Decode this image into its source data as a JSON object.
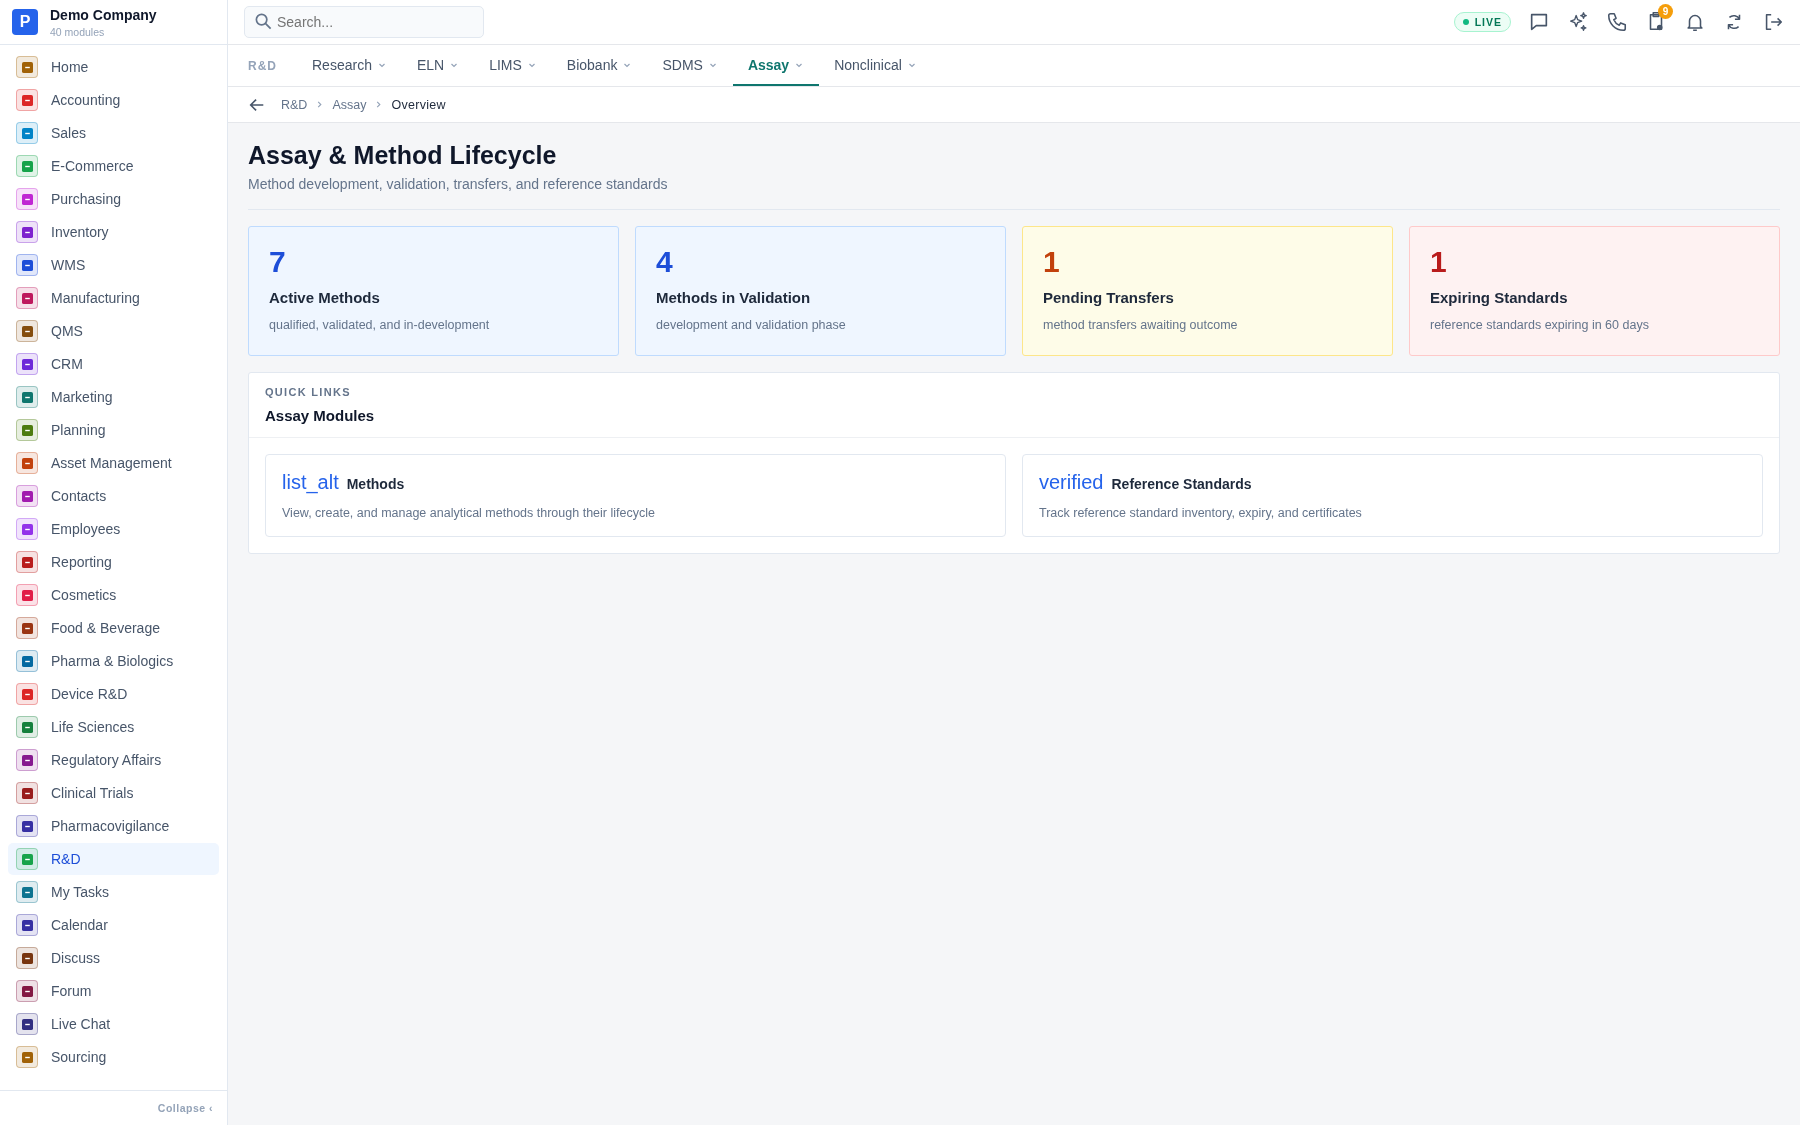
{
  "company": {
    "logo": "P",
    "name": "Demo Company",
    "subtitle": "40 modules"
  },
  "sidebar": {
    "items": [
      {
        "label": "Home",
        "color": "#a16207",
        "selected": false
      },
      {
        "label": "Accounting",
        "color": "#dc2626",
        "selected": false
      },
      {
        "label": "Sales",
        "color": "#0284c7",
        "selected": false
      },
      {
        "label": "E-Commerce",
        "color": "#16a34a",
        "selected": false
      },
      {
        "label": "Purchasing",
        "color": "#c026d3",
        "selected": false
      },
      {
        "label": "Inventory",
        "color": "#7e22ce",
        "selected": false
      },
      {
        "label": "WMS",
        "color": "#1d4ed8",
        "selected": false
      },
      {
        "label": "Manufacturing",
        "color": "#be185d",
        "selected": false
      },
      {
        "label": "QMS",
        "color": "#854d0e",
        "selected": false
      },
      {
        "label": "CRM",
        "color": "#6d28d9",
        "selected": false
      },
      {
        "label": "Marketing",
        "color": "#0f766e",
        "selected": false
      },
      {
        "label": "Planning",
        "color": "#4d7c0f",
        "selected": false
      },
      {
        "label": "Asset Management",
        "color": "#c2410c",
        "selected": false
      },
      {
        "label": "Contacts",
        "color": "#a21caf",
        "selected": false
      },
      {
        "label": "Employees",
        "color": "#9333ea",
        "selected": false
      },
      {
        "label": "Reporting",
        "color": "#b91c1c",
        "selected": false
      },
      {
        "label": "Cosmetics",
        "color": "#e11d48",
        "selected": false
      },
      {
        "label": "Food & Beverage",
        "color": "#9a3412",
        "selected": false
      },
      {
        "label": "Pharma & Biologics",
        "color": "#0369a1",
        "selected": false
      },
      {
        "label": "Device R&D",
        "color": "#dc2626",
        "selected": false
      },
      {
        "label": "Life Sciences",
        "color": "#15803d",
        "selected": false
      },
      {
        "label": "Regulatory Affairs",
        "color": "#86198f",
        "selected": false
      },
      {
        "label": "Clinical Trials",
        "color": "#991b1b",
        "selected": false
      },
      {
        "label": "Pharmacovigilance",
        "color": "#3730a3",
        "selected": false
      },
      {
        "label": "R&D",
        "color": "#16a34a",
        "selected": true
      },
      {
        "label": "My Tasks",
        "color": "#0e7490",
        "selected": false
      },
      {
        "label": "Calendar",
        "color": "#3730a3",
        "selected": false
      },
      {
        "label": "Discuss",
        "color": "#78350f",
        "selected": false
      },
      {
        "label": "Forum",
        "color": "#831843",
        "selected": false
      },
      {
        "label": "Live Chat",
        "color": "#312e81",
        "selected": false
      },
      {
        "label": "Sourcing",
        "color": "#a16207",
        "selected": false
      }
    ],
    "collapse": "Collapse",
    "collapse_icon": "‹"
  },
  "search": {
    "placeholder": "Search..."
  },
  "live_badge": "LIVE",
  "notification_count": "9",
  "nav": {
    "section": "R&D",
    "tabs": [
      {
        "label": "Research",
        "selected": false
      },
      {
        "label": "ELN",
        "selected": false
      },
      {
        "label": "LIMS",
        "selected": false
      },
      {
        "label": "Biobank",
        "selected": false
      },
      {
        "label": "SDMS",
        "selected": false
      },
      {
        "label": "Assay",
        "selected": true
      },
      {
        "label": "Nonclinical",
        "selected": false
      }
    ]
  },
  "breadcrumb": [
    "R&D",
    "Assay",
    "Overview"
  ],
  "page": {
    "title": "Assay & Method Lifecycle",
    "subtitle": "Method development, validation, transfers, and reference standards"
  },
  "stats": [
    {
      "kind": "info",
      "value": "7",
      "label": "Active Methods",
      "note": "qualified, validated, and in-development"
    },
    {
      "kind": "info",
      "value": "4",
      "label": "Methods in Validation",
      "note": "development and validation phase"
    },
    {
      "kind": "warning",
      "value": "1",
      "label": "Pending Transfers",
      "note": "method transfers awaiting outcome"
    },
    {
      "kind": "danger",
      "value": "1",
      "label": "Expiring Standards",
      "note": "reference standards expiring in 60 days"
    }
  ],
  "quick_links": {
    "eyebrow": "QUICK LINKS",
    "title": "Assay Modules",
    "links": [
      {
        "icon_text": "list_alt",
        "title": "Methods",
        "description": "View, create, and manage analytical methods through their lifecycle"
      },
      {
        "icon_text": "verified",
        "title": "Reference Standards",
        "description": "Track reference standard inventory, expiry, and certificates"
      }
    ]
  }
}
